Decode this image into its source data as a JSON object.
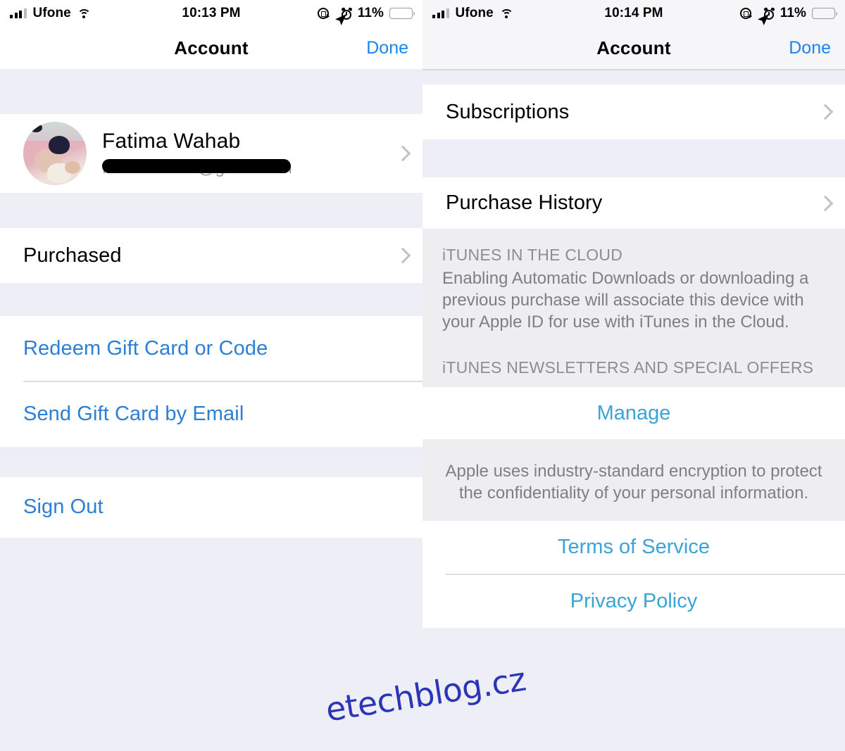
{
  "status_bar": {
    "carrier": "Ufone",
    "time_left": "10:13 PM",
    "time_right": "10:14 PM",
    "battery_percent": "11%",
    "icons": [
      "signal-bars-icon",
      "wifi-icon",
      "rotation-lock-icon",
      "location-arrow-icon",
      "alarm-clock-icon",
      "battery-icon"
    ]
  },
  "colors": {
    "accent_blue": "#1a85f0",
    "link_blue": "#2b7fd4",
    "soft_blue": "#3ca3d6",
    "group_bg": "#ffffff",
    "page_bg": "#eeeef6",
    "footer_bg": "#eeeef0",
    "battery_red": "#f23b32",
    "watermark_blue": "#2a35b8"
  },
  "left_screen": {
    "nav": {
      "title": "Account",
      "done_label": "Done"
    },
    "account": {
      "name": "Fatima Wahab",
      "email": "fatimawahab@gmail.com",
      "email_redacted": true,
      "avatar": "user-photo-avatar",
      "chevron": "chevron-right-icon"
    },
    "rows": [
      {
        "label": "Purchased",
        "type": "disclosure",
        "chevron": "chevron-right-icon"
      },
      {
        "label": "Redeem Gift Card or Code",
        "type": "link"
      },
      {
        "label": "Send Gift Card by Email",
        "type": "link"
      },
      {
        "label": "Sign Out",
        "type": "link"
      }
    ]
  },
  "right_screen": {
    "nav": {
      "title": "Account",
      "done_label": "Done"
    },
    "rows": [
      {
        "label": "Subscriptions",
        "type": "disclosure",
        "chevron": "chevron-right-icon"
      },
      {
        "label": "Purchase History",
        "type": "disclosure",
        "chevron": "chevron-right-icon"
      }
    ],
    "cloud_section": {
      "header": "iTUNES IN THE CLOUD",
      "body": "Enabling Automatic Downloads or downloading a previous purchase will associate this device with your Apple ID for use with iTunes in the Cloud."
    },
    "newsletters_section": {
      "header": "iTUNES NEWSLETTERS AND SPECIAL OFFERS",
      "manage_label": "Manage"
    },
    "encryption_note": "Apple uses industry-standard encryption to protect the confidentiality of your personal information.",
    "legal_links": [
      {
        "label": "Terms of Service"
      },
      {
        "label": "Privacy Policy"
      }
    ]
  },
  "watermark": {
    "text": "etechblog.cz"
  }
}
